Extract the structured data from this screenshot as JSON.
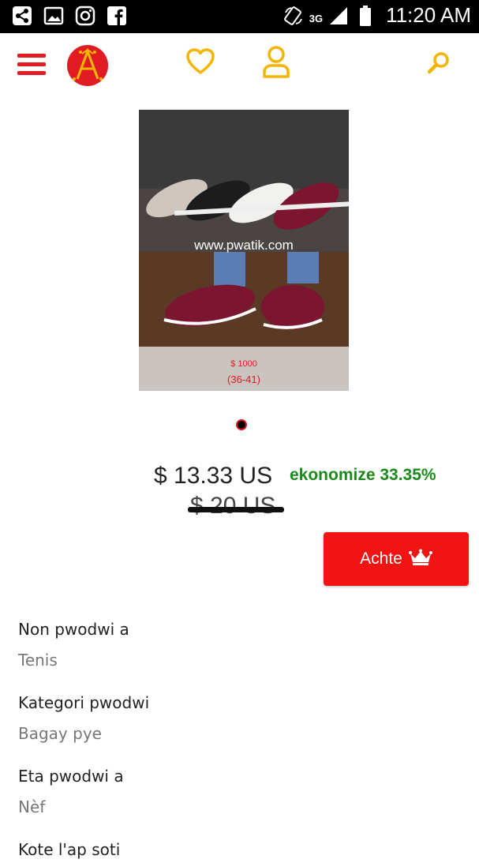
{
  "status_bar": {
    "network": "3G",
    "time": "11:20 AM"
  },
  "header": {
    "logo_letter": "A"
  },
  "product_image": {
    "watermark": "www.pwatik.com",
    "price_tag": "$ 1000",
    "size_range": "(36-41)"
  },
  "price": {
    "current": "$ 13.33 US",
    "original": "$ 20 US",
    "savings": "ekonomize 33.35%"
  },
  "buy_button": {
    "label": "Achte"
  },
  "details": [
    {
      "label": "Non pwodwi a",
      "value": "Tenis"
    },
    {
      "label": "Kategori pwodwi",
      "value": "Bagay pye"
    },
    {
      "label": "Eta pwodwi a",
      "value": "Nèf"
    },
    {
      "label": "Kote l'ap soti",
      "value": ""
    }
  ],
  "colors": {
    "brand_red": "#e11b22",
    "accent_yellow": "#f5b400",
    "savings_green": "#1a8a1a",
    "button_red": "#f21313"
  }
}
